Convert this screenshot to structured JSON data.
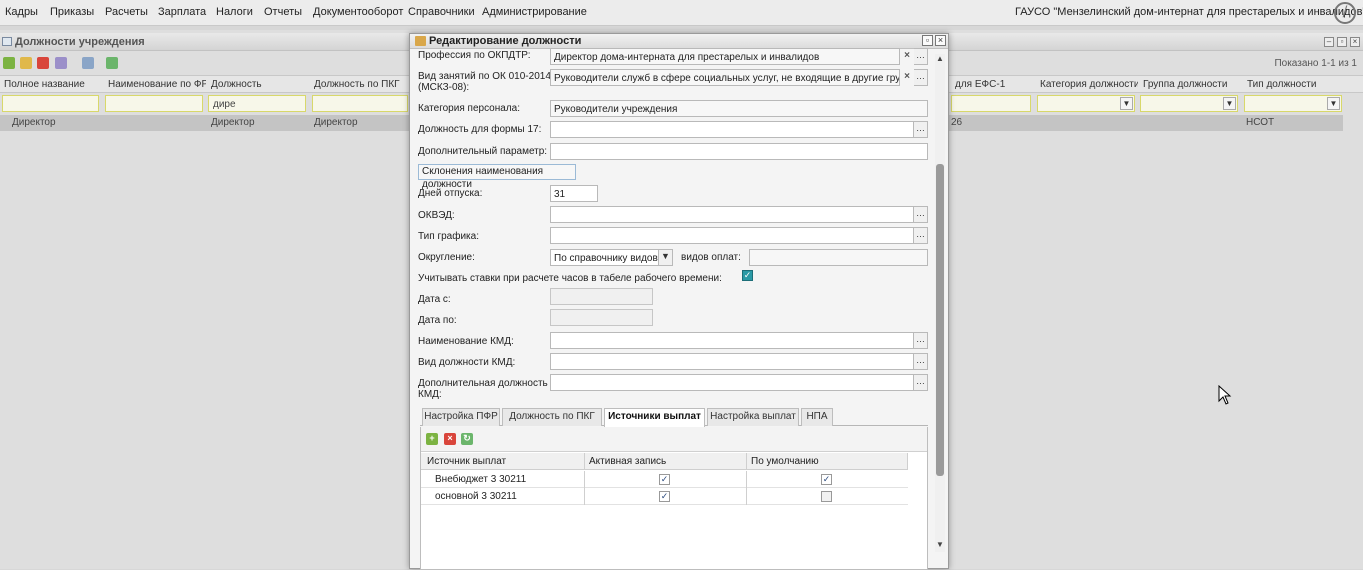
{
  "menu": {
    "items": [
      "Кадры",
      "Приказы",
      "Расчеты",
      "Зарплата",
      "Налоги",
      "Отчеты",
      "Документооборот",
      "Справочники",
      "Администрирование"
    ],
    "org_name": "ГАУСО \"Мензелинский дом-интернат для престарелых и инвалидов\"",
    "power_icon": "power-icon"
  },
  "bg_window": {
    "title": "Должности учреждения",
    "shown_count": "Показано 1-1 из 1",
    "columns": [
      "Полное название",
      "Наименование по ФР...",
      "Должность",
      "Должность по ПКГ",
      "для ЕФС-1",
      "Категория должности",
      "Группа должности",
      "Тип должности"
    ],
    "filter_value": "дире",
    "row": {
      "full_name": "Директор",
      "position": "Директор",
      "pkg_position": "Директор",
      "efs_code": "26",
      "position_type": "НСОТ"
    }
  },
  "modal": {
    "title": "Редактирование должности",
    "fields": {
      "okpdtr_label": "Профессия по ОКПДТР:",
      "okpdtr_value": "Директор дома-интерната для престарелых и инвалидов",
      "ok010_label_line1": "Вид занятий по ОК 010-2014",
      "ok010_label_line2": "(МСКЗ-08):",
      "ok010_value": "Руководители служб в сфере социальных услуг, не входящие в другие групп",
      "personnel_category_label": "Категория персонала:",
      "personnel_category_value": "Руководители учреждения",
      "form17_label": "Должность для формы 17:",
      "form17_value": "",
      "extra_param_label": "Дополнительный параметр:",
      "extra_param_value": "",
      "declension_button": "Склонения наименования должности",
      "vacation_days_label": "Дней отпуска:",
      "vacation_days_value": "31",
      "okved_label": "ОКВЭД:",
      "okved_value": "",
      "schedule_type_label": "Тип графика:",
      "schedule_type_value": "",
      "rounding_label": "Округление:",
      "rounding_value": "По справочнику видов",
      "payment_types_label": "видов оплат:",
      "payment_types_value": "",
      "rates_checkbox_label": "Учитывать ставки при расчете часов в табеле рабочего времени:",
      "rates_checked": true,
      "date_from_label": "Дата с:",
      "date_from_value": "",
      "date_to_label": "Дата по:",
      "date_to_value": "",
      "kmd_name_label": "Наименование КМД:",
      "kmd_name_value": "",
      "kmd_type_label": "Вид должности КМД:",
      "kmd_type_value": "",
      "kmd_extra_label_line1": "Дополнительная должность",
      "kmd_extra_label_line2": "КМД:",
      "kmd_extra_value": ""
    },
    "tabs": [
      "Настройка ПФР",
      "Должность по ПКГ",
      "Источники выплат",
      "Настройка выплат",
      "НПА"
    ],
    "active_tab": "Источники выплат",
    "subgrid": {
      "columns": [
        "Источник выплат",
        "Активная запись",
        "По умолчанию"
      ],
      "rows": [
        {
          "source": "Внебюджет 3 30211",
          "active": true,
          "default": true
        },
        {
          "source": "основной 3 30211",
          "active": true,
          "default": false
        }
      ]
    }
  },
  "colors": {
    "teal_check": "#2b9aa6",
    "filter_bg": "#f7f7e9",
    "selected_row": "#c4c4c4"
  }
}
